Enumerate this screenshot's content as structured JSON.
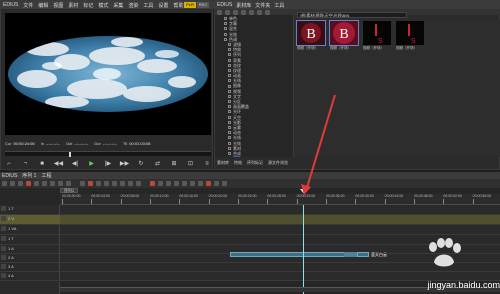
{
  "player": {
    "title_menu": [
      "EDIUS",
      "文件",
      "编辑",
      "视图",
      "素材",
      "标记",
      "模式",
      "采集",
      "渲染",
      "工具",
      "设置",
      "帮助"
    ],
    "pl_label": "PLR",
    "rec_label": "REC",
    "cur_label": "Cur",
    "cur_value": "00:00:24:06",
    "in_label": "In",
    "in_value": "--:--:--:--",
    "out_label": "Out",
    "out_value": "--:--:--:--",
    "dur_label": "Dur",
    "dur_value": "--:--:--:--",
    "ttl_label": "Ttl",
    "ttl_value": "00:01:03:06"
  },
  "bin": {
    "title_menu": [
      "EDIUS",
      "素材库",
      "文件夹",
      "工具"
    ],
    "path": "\\根\\素材\\视频\\天空\\光线\\BIN",
    "tree": [
      "单色",
      "字幕",
      "混合",
      "光效",
      "色调",
      "滤镜",
      "特效",
      "序列",
      "背景",
      "花纹",
      "纹理",
      "动画",
      "光线",
      "图像",
      "视频",
      "文字",
      "分区",
      "画面覆盖",
      "光环",
      "天空",
      "光影",
      "云雾",
      "动态",
      "光线",
      "光效",
      "素材",
      "合成",
      "BIN",
      "视频光影",
      "音频",
      "字幕",
      "图片"
    ],
    "selected_tree_item": "BIN",
    "thumbs": [
      {
        "caption": "视频（开场）",
        "letter": "B"
      },
      {
        "caption": "视频（开场）",
        "letter": "B"
      },
      {
        "caption": "视频（开场）",
        "letter": "S"
      },
      {
        "caption": "视频（开场）",
        "letter": "S"
      }
    ],
    "tabs": [
      "素材库",
      "特效",
      "序列标记",
      "源文件浏览"
    ]
  },
  "timeline": {
    "title_menu": [
      "EDIUS",
      "序列 1",
      "工程"
    ],
    "sequence_tab": "序列1",
    "ruler_ticks": [
      "00:00:00:00",
      "00:00:04:00",
      "00:00:08:00",
      "00:00:12:00",
      "00:00:16:00",
      "00:00:20:00",
      "00:00:24:00",
      "00:00:28:00",
      "00:00:32:00",
      "00:00:36:00",
      "00:00:40:00",
      "00:00:44:00",
      "00:00:48:00",
      "00:00:52:00",
      "00:00:56:00"
    ],
    "tracks": [
      {
        "label": "1 T",
        "kind": "t"
      },
      {
        "label": "2 V",
        "kind": "v"
      },
      {
        "label": "1 VA",
        "kind": "va"
      },
      {
        "label": "1 T",
        "kind": "t"
      },
      {
        "label": "1 A",
        "kind": "a"
      },
      {
        "label": "2 A",
        "kind": "a"
      },
      {
        "label": "3 A",
        "kind": "a"
      },
      {
        "label": "4 A",
        "kind": "a"
      }
    ],
    "clip_label": "蓝天白云"
  },
  "watermark": {
    "text": "jingyan.baidu.com"
  },
  "colors": {
    "accent_arrow": "#e03a3a",
    "clip": "#3d6e84",
    "video_track": "#504f2f",
    "playhead": "#8fe0e0"
  }
}
